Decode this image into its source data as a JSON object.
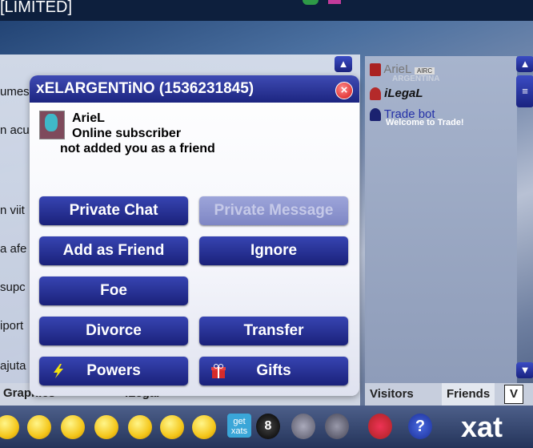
{
  "window": {
    "title_fragment": "[LIMITED]"
  },
  "chat": {
    "lines": [
      "umes",
      "n acu",
      "n viit",
      "a afe",
      "supc",
      "iport",
      "ajuta"
    ]
  },
  "bottom_tabs": {
    "left": "Graphics",
    "mid": "ILegal"
  },
  "users": [
    {
      "name": "ArieL",
      "tag": "ARGENTINA",
      "badge": "AIRC"
    },
    {
      "name": "iLegaL"
    },
    {
      "name": "Trade bot",
      "status": "Welcome to Trade!"
    }
  ],
  "tabs": {
    "visitors": "Visitors",
    "friends": "Friends",
    "toggle": "V"
  },
  "dialog": {
    "title": "xELARGENTiNO (1536231845)",
    "close": "×",
    "user_name": "ArieL",
    "status": "Online subscriber",
    "friend_status": "not added you as a friend",
    "buttons": {
      "private_chat": "Private Chat",
      "private_message": "Private Message",
      "add_friend": "Add as Friend",
      "ignore": "Ignore",
      "foe": "Foe",
      "divorce": "Divorce",
      "transfer": "Transfer",
      "powers": "Powers",
      "gifts": "Gifts"
    }
  },
  "footer": {
    "get_xats": "get xats",
    "brand": "xat",
    "help": "?",
    "eight": "8"
  }
}
